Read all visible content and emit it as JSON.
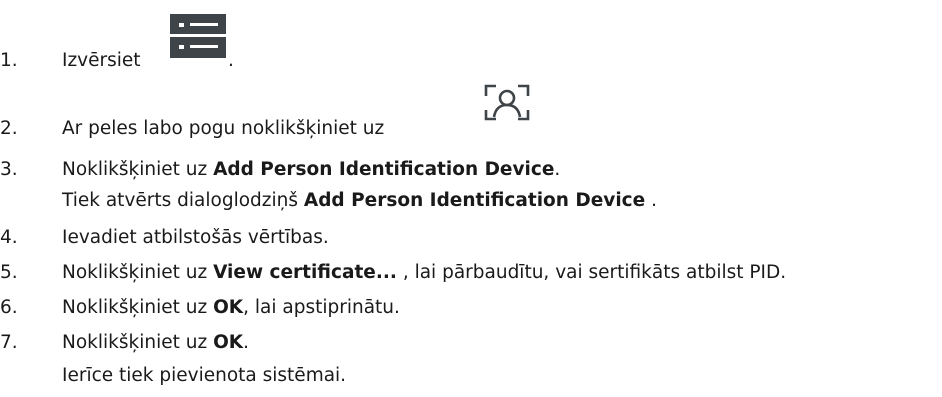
{
  "steps": [
    {
      "num": "1.",
      "text": "Izvērsiet",
      "after_icon": ".",
      "icon": "list-view-icon"
    },
    {
      "num": "2.",
      "text": "Ar peles labo pogu noklikšķiniet uz",
      "icon": "person-identification-icon"
    },
    {
      "num": "3.",
      "pre": "Noklikšķiniet uz ",
      "bold": "Add Person Identification Device",
      "post": "."
    },
    {
      "num": "4.",
      "text": "Ievadiet atbilstošās vērtības."
    },
    {
      "num": "5.",
      "pre": "Noklikšķiniet uz ",
      "bold": "View certificate...",
      "post": " , lai pārbaudītu, vai sertifikāts atbilst PID."
    },
    {
      "num": "6.",
      "pre": "Noklikšķiniet uz ",
      "bold": "OK",
      "post": ", lai apstiprinātu."
    },
    {
      "num": "7.",
      "pre": "Noklikšķiniet uz ",
      "bold": "OK",
      "post": "."
    }
  ],
  "results": {
    "step3": {
      "pre": "Tiek atvērts dialoglodziņš ",
      "bold": "Add Person Identification Device",
      "post": " ."
    },
    "step7": {
      "text": "Ierīce tiek pievienota sistēmai."
    }
  },
  "colors": {
    "icon_dark": "#3f4448",
    "text": "#1a1a1a"
  }
}
